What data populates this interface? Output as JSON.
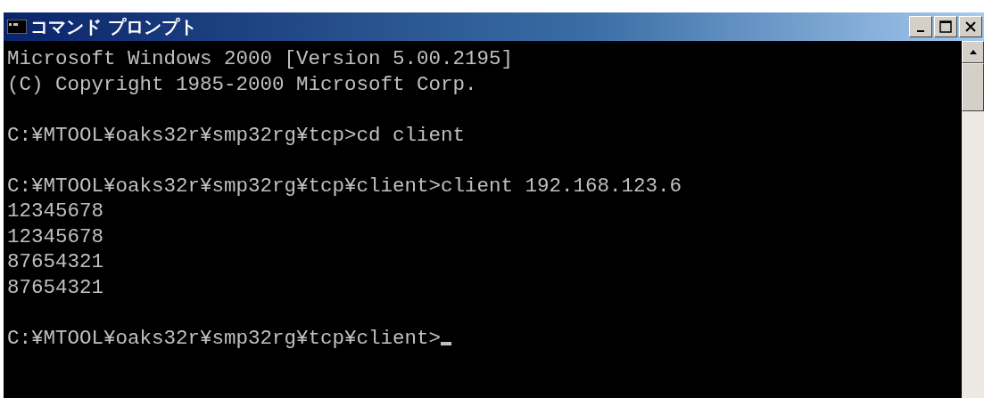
{
  "window": {
    "title": "コマンド プロンプト"
  },
  "console": {
    "blocks": [
      [
        "Microsoft Windows 2000 [Version 5.00.2195]",
        "(C) Copyright 1985-2000 Microsoft Corp."
      ],
      [
        "C:¥MTOOL¥oaks32r¥smp32rg¥tcp>cd client"
      ],
      [
        "C:¥MTOOL¥oaks32r¥smp32rg¥tcp¥client>client 192.168.123.6",
        "12345678",
        "12345678",
        "87654321",
        "87654321"
      ],
      [
        "C:¥MTOOL¥oaks32r¥smp32rg¥tcp¥client>"
      ]
    ],
    "cursor_visible": true
  }
}
